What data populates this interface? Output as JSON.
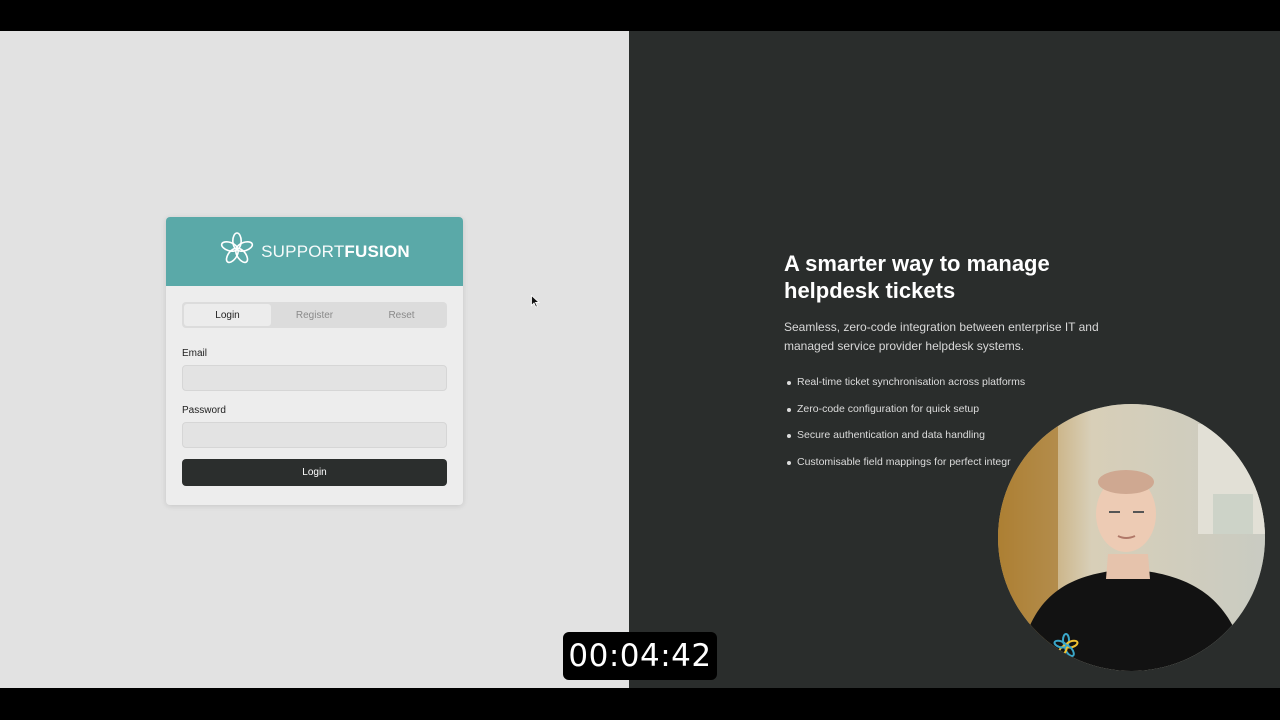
{
  "brand": {
    "name_light": "SUPPORT",
    "name_bold": "FUSION",
    "header_color": "#5aa9a8"
  },
  "auth_card": {
    "tabs": [
      {
        "label": "Login",
        "active": true
      },
      {
        "label": "Register",
        "active": false
      },
      {
        "label": "Reset",
        "active": false
      }
    ],
    "email": {
      "label": "Email",
      "value": "",
      "placeholder": ""
    },
    "password": {
      "label": "Password",
      "value": "",
      "placeholder": ""
    },
    "submit_label": "Login"
  },
  "promo": {
    "headline": "A smarter way to manage helpdesk tickets",
    "subtitle": "Seamless, zero-code integration between enterprise IT and managed service provider helpdesk systems.",
    "features": [
      "Real-time ticket synchronisation across platforms",
      "Zero-code configuration for quick setup",
      "Secure authentication and data handling",
      "Customisable field mappings for perfect integr"
    ]
  },
  "recording": {
    "elapsed": "00:04:42"
  },
  "colors": {
    "left_bg": "#e2e2e2",
    "right_bg": "#2a2d2c",
    "button_bg": "#2b2e2d"
  }
}
